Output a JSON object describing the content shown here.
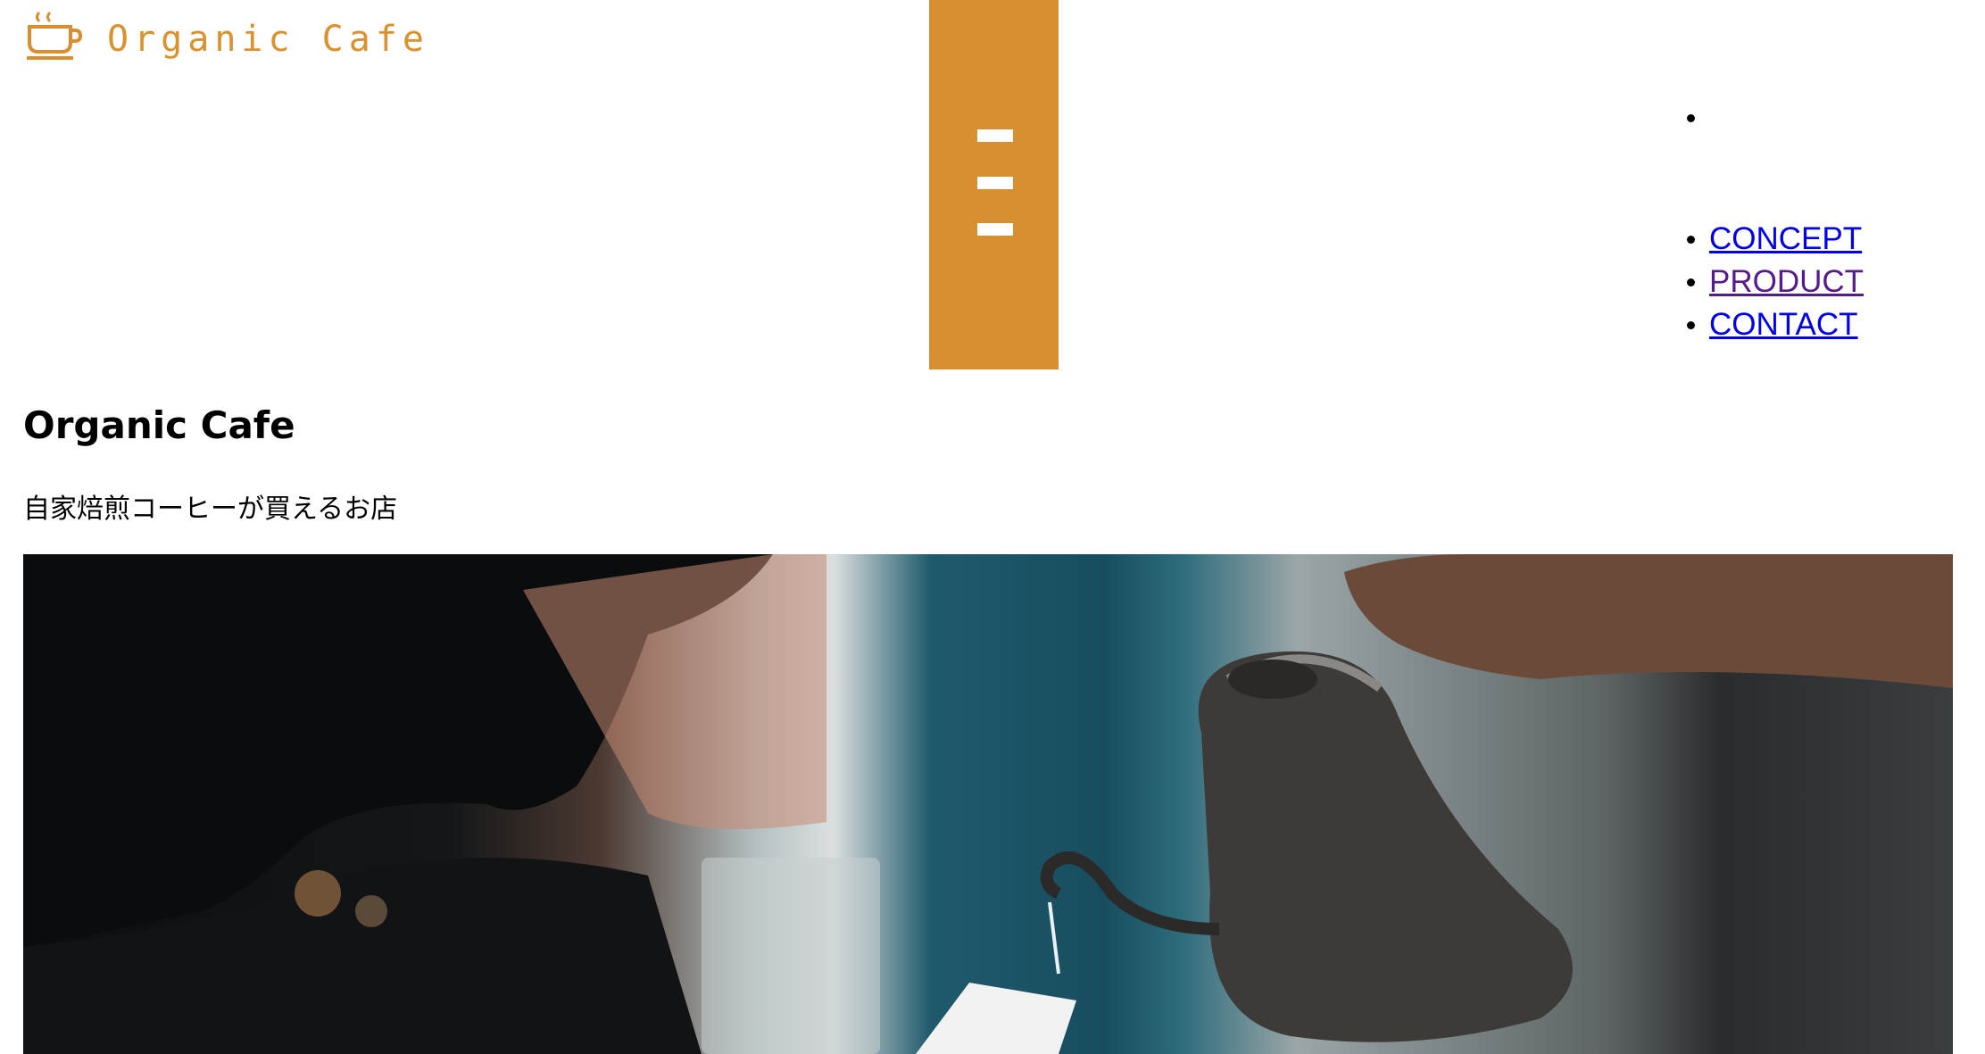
{
  "header": {
    "logo_text": "Organic Cafe",
    "logo_icon": "coffee-cup-icon",
    "menu_icon": "hamburger-menu-icon",
    "brand_color": "#d88f31"
  },
  "nav": {
    "items": [
      {
        "label": ""
      },
      {
        "label": "CONCEPT"
      },
      {
        "label": "PRODUCT"
      },
      {
        "label": "CONTACT"
      }
    ]
  },
  "main": {
    "title": "Organic Cafe",
    "tagline": "自家焙煎コーヒーが買えるお店"
  },
  "colors": {
    "link": "#0000ee",
    "visited_link": "#551a8b",
    "accent": "#d88f31"
  }
}
